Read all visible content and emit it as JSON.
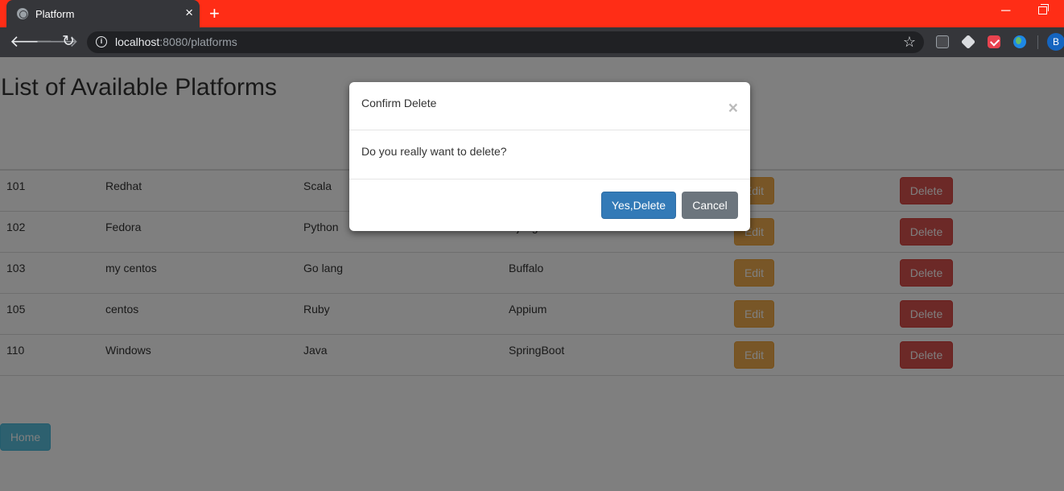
{
  "browser": {
    "tab_title": "Platform",
    "tab_close": "×",
    "new_tab": "+",
    "url_host": "localhost",
    "url_rest": ":8080/platforms",
    "profile_initial": "B",
    "minimize": "─"
  },
  "page": {
    "title": "List of Available Platforms",
    "rows": [
      {
        "id": "101",
        "name": "Redhat",
        "language": "Scala",
        "framework": "",
        "edit": "Edit",
        "delete": "Delete"
      },
      {
        "id": "102",
        "name": "Fedora",
        "language": "Python",
        "framework": "Django",
        "edit": "Edit",
        "delete": "Delete"
      },
      {
        "id": "103",
        "name": "my centos",
        "language": "Go lang",
        "framework": "Buffalo",
        "edit": "Edit",
        "delete": "Delete"
      },
      {
        "id": "105",
        "name": "centos",
        "language": "Ruby",
        "framework": "Appium",
        "edit": "Edit",
        "delete": "Delete"
      },
      {
        "id": "110",
        "name": "Windows",
        "language": "Java",
        "framework": "SpringBoot",
        "edit": "Edit",
        "delete": "Delete"
      }
    ],
    "home_label": "Home"
  },
  "modal": {
    "title": "Confirm Delete",
    "close": "×",
    "message": "Do you really want to delete?",
    "confirm_label": "Yes,Delete",
    "cancel_label": "Cancel"
  },
  "colors": {
    "title_bar": "#ff2d16",
    "edit": "#f0ad4e",
    "delete": "#d9534f",
    "home": "#5bc0de",
    "confirm": "#337ab7",
    "cancel": "#6c757d"
  }
}
